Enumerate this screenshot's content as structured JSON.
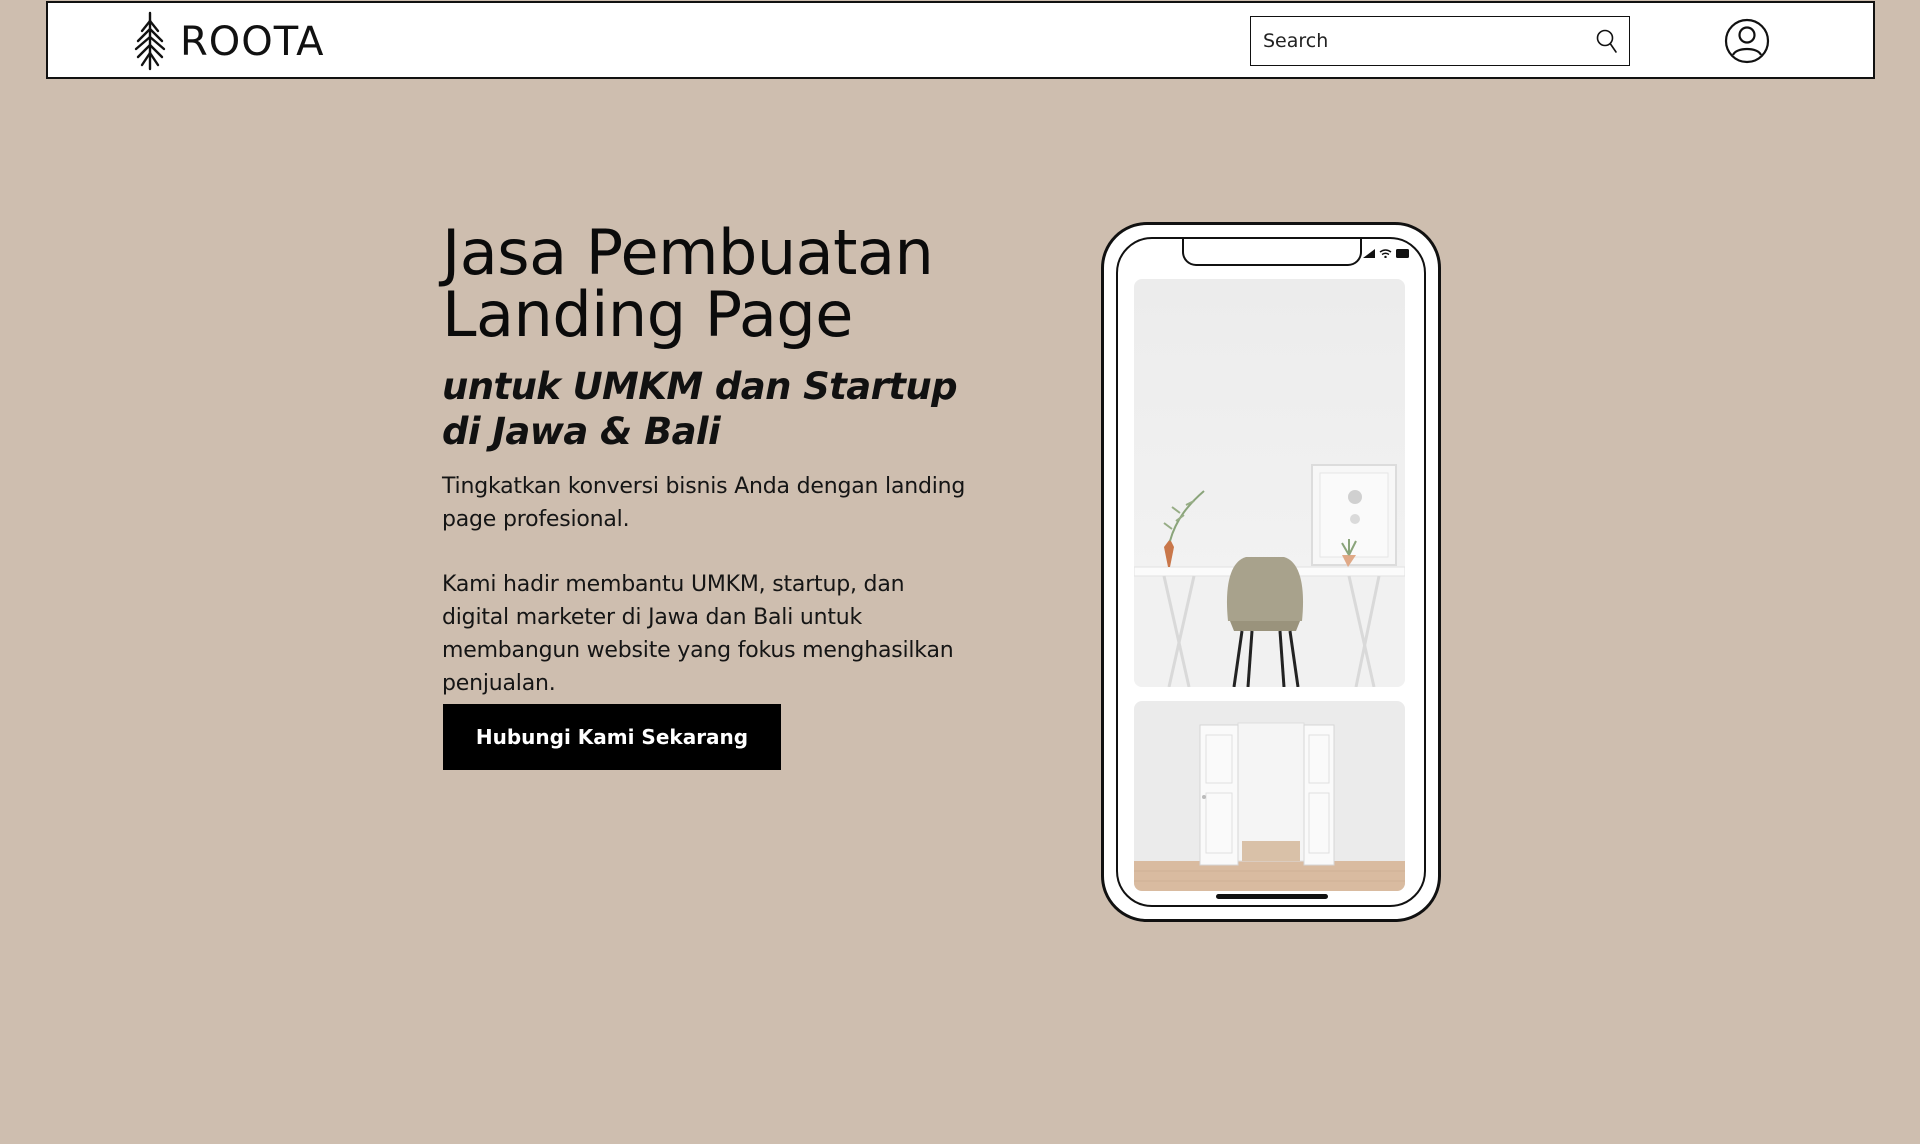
{
  "header": {
    "brand": "ROOTA",
    "search": {
      "placeholder": "Search",
      "value": ""
    }
  },
  "hero": {
    "title_line1": "Jasa Pembuatan",
    "title_line2": "Landing Page",
    "subtitle": "untuk UMKM dan Startup di Jawa & Bali",
    "paragraph1": "Tingkatkan konversi bisnis Anda dengan landing page profesional.",
    "paragraph2": "Kami hadir membantu UMKM, startup, dan digital marketer di Jawa dan Bali untuk membangun website yang fokus menghasilkan penjualan.",
    "cta_label": "Hubungi Kami Sekarang"
  },
  "colors": {
    "background": "#cebeaf",
    "header_bg": "#ffffff",
    "button_bg": "#000000",
    "text": "#0a0a0a"
  },
  "icons": {
    "logo": "tree-roots-icon",
    "search": "search-icon",
    "account": "user-circle-icon"
  }
}
